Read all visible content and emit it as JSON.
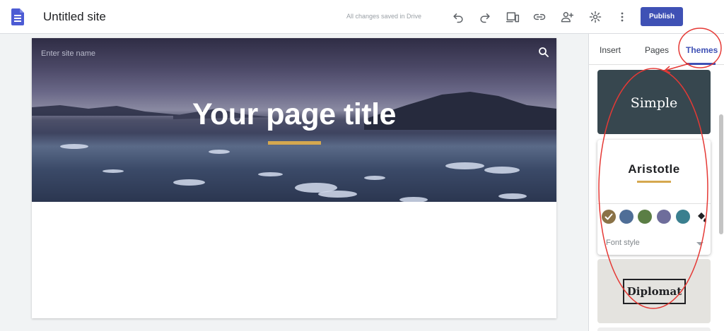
{
  "app": {
    "title": "Untitled site",
    "save_status": "All changes saved in Drive",
    "logo_icon": "google-sites-logo-icon"
  },
  "toolbar": {
    "icons": [
      "undo-icon",
      "redo-icon",
      "preview-devices-icon",
      "link-icon",
      "share-person-icon",
      "settings-gear-icon",
      "more-vert-icon"
    ],
    "publish_label": "Publish",
    "accent_color": "#3f51b5"
  },
  "hero": {
    "site_name_placeholder": "Enter site name",
    "title": "Your page title",
    "underline_color": "#d5a84f"
  },
  "sidebar": {
    "tabs": [
      {
        "label": "Insert",
        "active": false
      },
      {
        "label": "Pages",
        "active": false
      },
      {
        "label": "Themes",
        "active": true
      }
    ],
    "themes": [
      {
        "name": "Simple",
        "bg": "#37474f"
      },
      {
        "name": "Aristotle",
        "selected": true,
        "colors": [
          "#8a7247",
          "#4f6e97",
          "#5b7e45",
          "#6e6d9b",
          "#3a7f8f"
        ],
        "selected_color_index": 0,
        "font_style_label": "Font style"
      },
      {
        "name": "Diplomat",
        "bg": "#e4e3df"
      }
    ]
  },
  "annotation_color": "#e53935"
}
